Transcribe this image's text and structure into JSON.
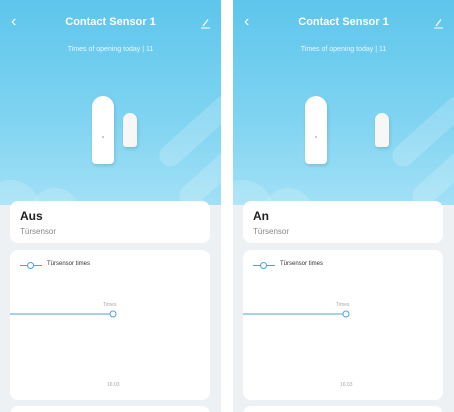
{
  "screens": [
    {
      "header": {
        "back_icon": "chevron-left-icon",
        "title": "Contact Sensor 1",
        "edit_icon": "pencil-icon"
      },
      "subtitle": "Times of opening today | 11",
      "status": {
        "label": "Aus",
        "device_type": "Türsensor"
      },
      "chart": {
        "legend_label": "Türsensor times",
        "value_label": "Times",
        "x_label": "16:03"
      }
    },
    {
      "header": {
        "back_icon": "chevron-left-icon",
        "title": "Contact Sensor 1",
        "edit_icon": "pencil-icon"
      },
      "subtitle": "Times of opening today | 11",
      "status": {
        "label": "An",
        "device_type": "Türsensor"
      },
      "chart": {
        "legend_label": "Türsensor times",
        "value_label": "Times",
        "x_label": "16:03"
      }
    }
  ],
  "colors": {
    "accent": "#4ba3d9",
    "hero_top": "#5ec5ec",
    "hero_bottom": "#a2e0f6",
    "background": "#eef1f4"
  }
}
